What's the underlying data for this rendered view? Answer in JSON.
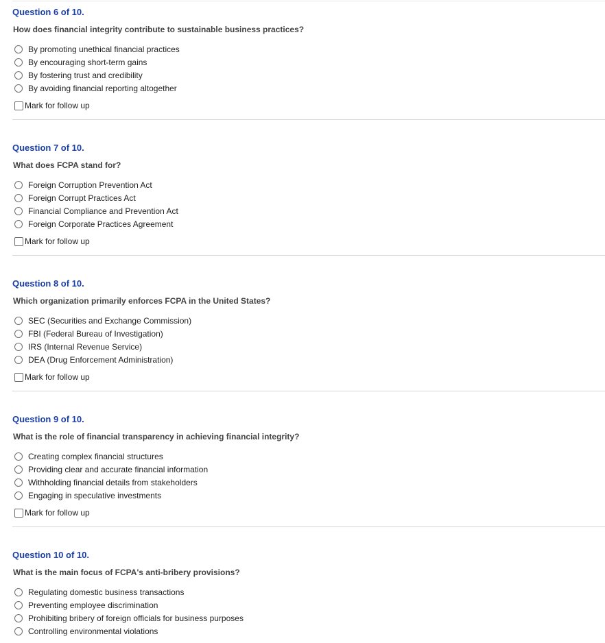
{
  "follow_up_label": "Mark for follow up",
  "questions": [
    {
      "header": "Question 6 of 10.",
      "text": "How does financial integrity contribute to sustainable business practices?",
      "options": [
        "By promoting unethical financial practices",
        "By encouraging short-term gains",
        "By fostering trust and credibility",
        "By avoiding financial reporting altogether"
      ]
    },
    {
      "header": "Question 7 of 10.",
      "text": "What does FCPA stand for?",
      "options": [
        "Foreign Corruption Prevention Act",
        "Foreign Corrupt Practices Act",
        "Financial Compliance and Prevention Act",
        "Foreign Corporate Practices Agreement"
      ]
    },
    {
      "header": "Question 8 of 10.",
      "text": "Which organization primarily enforces FCPA in the United States?",
      "options": [
        "SEC (Securities and Exchange Commission)",
        "FBI (Federal Bureau of Investigation)",
        "IRS (Internal Revenue Service)",
        "DEA (Drug Enforcement Administration)"
      ]
    },
    {
      "header": "Question 9 of 10.",
      "text": "What is the role of financial transparency in achieving financial integrity?",
      "options": [
        "Creating complex financial structures",
        "Providing clear and accurate financial information",
        "Withholding financial details from stakeholders",
        "Engaging in speculative investments"
      ]
    },
    {
      "header": "Question 10 of 10.",
      "text": "What is the main focus of FCPA's anti-bribery provisions?",
      "options": [
        "Regulating domestic business transactions",
        "Preventing employee discrimination",
        "Prohibiting bribery of foreign officials for business purposes",
        "Controlling environmental violations"
      ]
    }
  ]
}
